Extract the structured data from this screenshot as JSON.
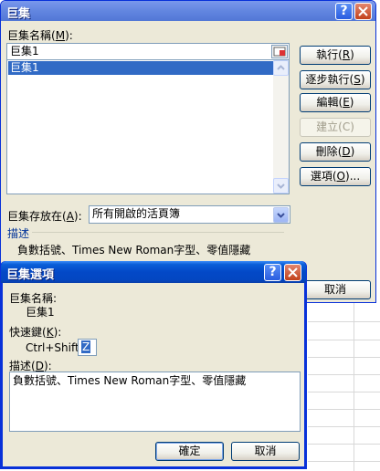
{
  "macro_dialog": {
    "title": "巨集",
    "help_glyph": "?",
    "name_label": "巨集名稱",
    "name_accel": "M",
    "name_value": "巨集1",
    "list_items": [
      "巨集1"
    ],
    "buttons": {
      "run": "執行",
      "run_accel": "R",
      "step": "逐步執行",
      "step_accel": "S",
      "edit": "編輯",
      "edit_accel": "E",
      "create": "建立",
      "create_accel": "C",
      "delete": "刪除",
      "delete_accel": "D",
      "options": "選項",
      "options_accel": "O",
      "options_suffix": "...",
      "cancel": "取消"
    },
    "store_label": "巨集存放在",
    "store_accel": "A",
    "store_value": "所有開啟的活頁簿",
    "description_label": "描述",
    "description_text": "負數括號、Times New Roman字型、零值隱藏"
  },
  "options_dialog": {
    "title": "巨集選項",
    "help_glyph": "?",
    "name_label": "巨集名稱:",
    "name_value": "巨集1",
    "shortcut_label": "快速鍵",
    "shortcut_accel": "K",
    "shortcut_prefix": "Ctrl+Shift+",
    "shortcut_value": "Z",
    "description_label": "描述",
    "description_accel": "D",
    "description_value": "負數括號、Times New Roman字型、零值隱藏",
    "ok": "確定",
    "cancel": "取消"
  }
}
